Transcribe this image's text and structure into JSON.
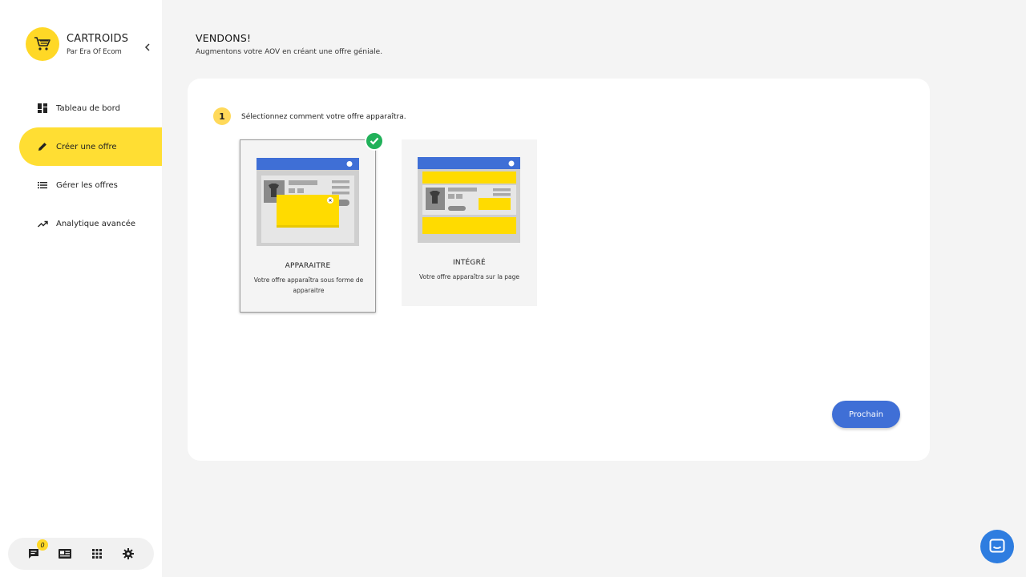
{
  "sidebar": {
    "brand_title": "CARTROIDS",
    "brand_subtitle": "Par Era Of Ecom",
    "items": [
      {
        "label": "Tableau de bord",
        "icon": "dashboard-icon"
      },
      {
        "label": "Créer une offre",
        "icon": "pencil-icon",
        "active": true
      },
      {
        "label": "Gérer les offres",
        "icon": "list-icon"
      },
      {
        "label": "Analytique avancée",
        "icon": "trending-icon"
      }
    ],
    "bottom": {
      "notification_count": "0",
      "icons": [
        "chat-icon",
        "news-icon",
        "apps-grid-icon",
        "settings-icon"
      ]
    }
  },
  "header": {
    "title": "VENDONS!",
    "subtitle": "Augmentons votre AOV en créant une offre géniale."
  },
  "step": {
    "number": "1",
    "text": "Sélectionnez comment votre offre apparaîtra."
  },
  "options": [
    {
      "title": "APPARAITRE",
      "description": "Votre offre apparaîtra sous forme de apparaitre",
      "selected": true
    },
    {
      "title": "INTÉGRÉ",
      "description": "Votre offre apparaîtra sur la page",
      "selected": false
    }
  ],
  "next_button": "Prochain",
  "colors": {
    "accent_yellow": "#ffde33",
    "primary_blue": "#3f6fd6",
    "check_green": "#21b15a"
  }
}
